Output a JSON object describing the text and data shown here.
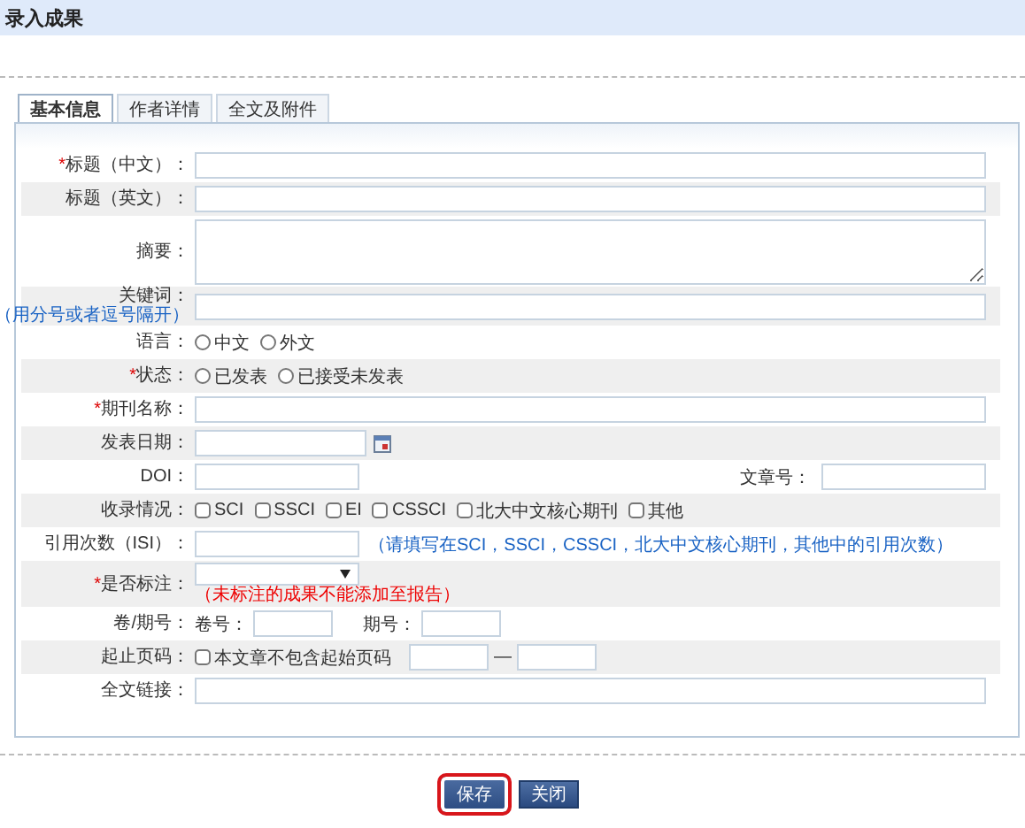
{
  "header": {
    "title": "录入成果"
  },
  "tabs": [
    {
      "label": "基本信息",
      "selected": true
    },
    {
      "label": "作者详情",
      "selected": false
    },
    {
      "label": "全文及附件",
      "selected": false
    }
  ],
  "rows": [
    {
      "kind": "text",
      "label": "标题（中文）：",
      "required_mark": "*"
    },
    {
      "kind": "text",
      "label": "标题（英文）："
    },
    {
      "kind": "textarea",
      "label": "摘要："
    },
    {
      "kind": "text",
      "label": "关键词：",
      "hint": "（用分号或者逗号隔开）"
    },
    {
      "kind": "radio",
      "label": "语言：",
      "options": [
        {
          "label": "中文",
          "selected": false
        },
        {
          "label": "外文",
          "selected": false
        }
      ]
    },
    {
      "kind": "radio",
      "label": "状态：",
      "required_mark": "*",
      "options": [
        {
          "label": "已发表",
          "selected": false
        },
        {
          "label": "已接受未发表",
          "selected": false
        }
      ]
    },
    {
      "kind": "text",
      "label": "期刊名称：",
      "required_mark": "*"
    },
    {
      "kind": "date",
      "label": "发表日期："
    },
    {
      "kind": "pair",
      "label": "DOI：",
      "second_label": "文章号："
    },
    {
      "kind": "checks",
      "label": "收录情况：",
      "options": [
        {
          "label": "SCI",
          "checked": false
        },
        {
          "label": "SSCI",
          "checked": false
        },
        {
          "label": "EI",
          "checked": false
        },
        {
          "label": "CSSCI",
          "checked": false
        },
        {
          "label": "北大中文核心期刊",
          "checked": false
        },
        {
          "label": "其他",
          "checked": false
        }
      ]
    },
    {
      "kind": "hinted",
      "label": "引用次数（ISI）：",
      "hint": "（请填写在SCI，SSCI，CSSCI，北大中文核心期刊，其他中的引用次数）"
    },
    {
      "kind": "select",
      "label": "是否标注：",
      "warning": "（未标注的成果不能添加至报告）",
      "required_mark": "*"
    },
    {
      "kind": "volume",
      "label": "卷/期号：",
      "parts": [
        "卷号：",
        "期号："
      ]
    },
    {
      "kind": "pages",
      "label": "起止页码：",
      "check_label": "本文章不包含起始页码",
      "checked": false,
      "dash": "—"
    },
    {
      "kind": "text",
      "label": "全文链接："
    }
  ],
  "buttons": [
    {
      "label": "保存",
      "highlighted": true
    },
    {
      "label": "关闭",
      "highlighted": false
    }
  ]
}
